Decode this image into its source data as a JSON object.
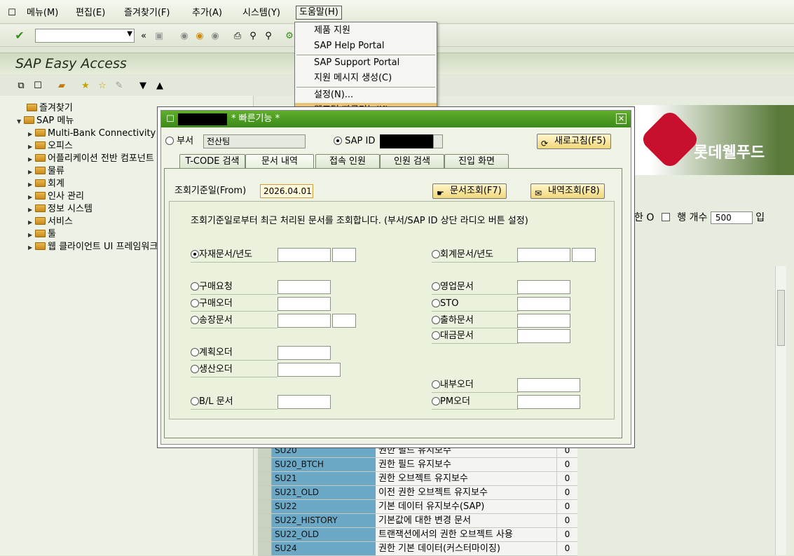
{
  "menubar": {
    "items": [
      "메뉴(M)",
      "편집(E)",
      "즐겨찾기(F)",
      "추가(A)",
      "시스템(Y)",
      "도움말(H)"
    ]
  },
  "app": {
    "title": "SAP Easy Access"
  },
  "help_menu": {
    "items": [
      "제품 지원",
      "SAP Help Portal",
      "SAP Support Portal",
      "지원 메시지 생성(C)",
      "설정(N)...",
      "웹포털 빠른기능(K)"
    ]
  },
  "tree": {
    "items": [
      "즐겨찾기",
      "SAP 메뉴",
      "Multi-Bank Connectivity",
      "오피스",
      "어플리케이션 전반 컴포넌트",
      "물류",
      "회계",
      "인사 관리",
      "정보 시스템",
      "서비스",
      "툴",
      "웹 클라이언트 UI 프레임워크"
    ]
  },
  "right": {
    "logo_text": "롯데웰푸드",
    "row_info_prefix": "한 O",
    "row_count_label": "행 개수",
    "row_count": "500",
    "row_extra": "입"
  },
  "grid": {
    "rows": [
      {
        "code": "SU20",
        "desc": "권한 필드 유지보수",
        "num": "0"
      },
      {
        "code": "SU20_BTCH",
        "desc": "권한 필드 유지보수",
        "num": "0"
      },
      {
        "code": "SU21",
        "desc": "권한 오브젝트 유지보수",
        "num": "0"
      },
      {
        "code": "SU21_OLD",
        "desc": "이전 권한 오브젝트 유지보수",
        "num": "0"
      },
      {
        "code": "SU22",
        "desc": "기본 데이터 유지보수(SAP)",
        "num": "0"
      },
      {
        "code": "SU22_HISTORY",
        "desc": "기본값에 대한 변경 문서",
        "num": "0"
      },
      {
        "code": "SU22_OLD",
        "desc": "트랜잭션에서의 권한 오브젝트 사용",
        "num": "0"
      },
      {
        "code": "SU24",
        "desc": "권한 기본 데이터(커스터마이징)",
        "num": "0"
      }
    ]
  },
  "dialog": {
    "title": "* 빠른기능 *",
    "dept_label": "부서",
    "dept_value": "전산팀",
    "sapid_label": "SAP ID",
    "refresh_button": "새로고침(F5)",
    "tabs": [
      "T-CODE 검색",
      "문서 내역",
      "접속 인원",
      "인원 검색",
      "진입 화면"
    ],
    "date_label": "조회기준일(From)",
    "date_value": "2026.04.01",
    "doc_query_button": "문서조회(F7)",
    "hist_query_button": "내역조회(F8)",
    "description": "조회기준일로부터 최근 처리된 문서를 조회합니다. (부서/SAP ID 상단 라디오 버튼 설정)",
    "left_options": [
      "자재문서/년도",
      "구매요청",
      "구매오더",
      "송장문서",
      "계획오더",
      "생산오더",
      "B/L 문서"
    ],
    "right_options": [
      "회계문서/년도",
      "영업문서",
      "STO",
      "출하문서",
      "대금문서",
      "내부오더",
      "PM오더"
    ]
  }
}
